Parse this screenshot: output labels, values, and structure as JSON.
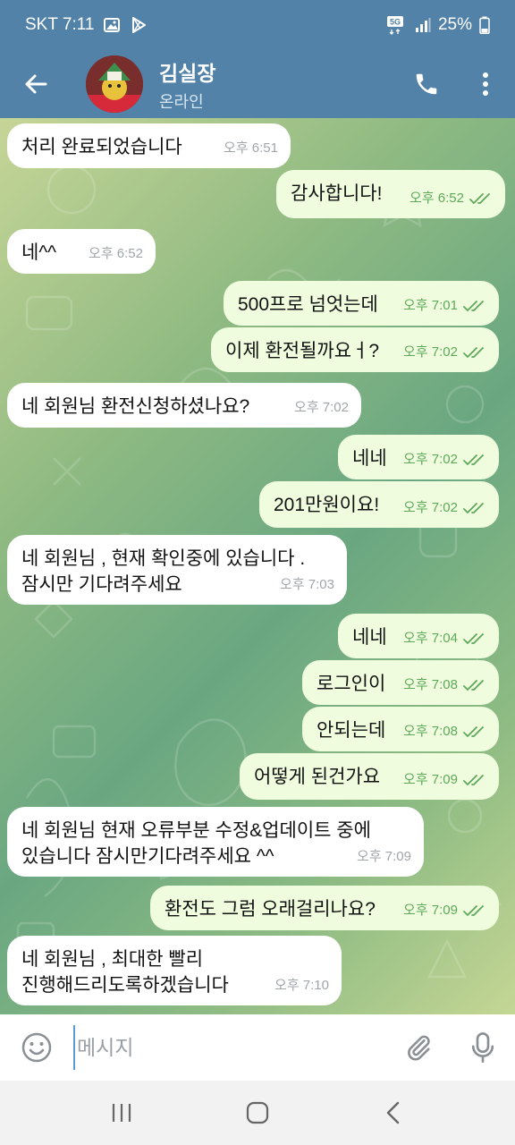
{
  "status_bar": {
    "carrier_time": "SKT 7:11",
    "network": "5G",
    "battery": "25%",
    "icons": [
      "image-icon",
      "play-store-icon",
      "5g-icon",
      "signal-icon",
      "battery-icon"
    ]
  },
  "header": {
    "name": "김실장",
    "status": "온라인",
    "icons": [
      "back-arrow-icon",
      "phone-icon",
      "more-vert-icon"
    ]
  },
  "messages": [
    {
      "dir": "in",
      "text": "처리 완료되었습니다",
      "time": "오후 6:51"
    },
    {
      "dir": "out",
      "text": "감사합니다!",
      "time": "오후 6:52",
      "read": true
    },
    {
      "dir": "in",
      "text": "네^^",
      "time": "오후 6:52"
    },
    {
      "dir": "out",
      "text": "500프로 넘엇는데",
      "time": "오후 7:01",
      "read": true
    },
    {
      "dir": "out",
      "text": "이제 환전될까요ㅓ?",
      "time": "오후 7:02",
      "read": true
    },
    {
      "dir": "in",
      "text": "네 회원님 환전신청하셨나요?",
      "time": "오후 7:02"
    },
    {
      "dir": "out",
      "text": "네네",
      "time": "오후 7:02",
      "read": true
    },
    {
      "dir": "out",
      "text": "201만원이요!",
      "time": "오후 7:02",
      "read": true
    },
    {
      "dir": "in",
      "text": "네 회원님 , 현재 확인중에 있습니다 .\n잠시만 기다려주세요",
      "time": "오후 7:03"
    },
    {
      "dir": "out",
      "text": "네네",
      "time": "오후 7:04",
      "read": true
    },
    {
      "dir": "out",
      "text": "로그인이",
      "time": "오후 7:08",
      "read": true
    },
    {
      "dir": "out",
      "text": "안되는데",
      "time": "오후 7:08",
      "read": true
    },
    {
      "dir": "out",
      "text": "어떻게 된건가요",
      "time": "오후 7:09",
      "read": true
    },
    {
      "dir": "in",
      "text": "네 회원님 현재 오류부분 수정&업데이트 중에\n있습니다 잠시만기다려주세요 ^^",
      "time": "오후 7:09"
    },
    {
      "dir": "out",
      "text": "환전도 그럼 오래걸리나요?",
      "time": "오후 7:09",
      "read": true
    },
    {
      "dir": "in",
      "text": "네 회원님 , 최대한 빨리\n진행해드리도록하겠습니다",
      "time": "오후 7:10"
    }
  ],
  "input": {
    "placeholder": "메시지",
    "icons": [
      "emoji-icon",
      "attach-icon",
      "mic-icon"
    ]
  },
  "nav": {
    "icons": [
      "recent-apps-icon",
      "home-icon",
      "back-icon"
    ]
  },
  "colors": {
    "header": "#5282a8",
    "incoming_bubble": "#ffffff",
    "outgoing_bubble": "#effdde",
    "outgoing_meta": "#5ea85a",
    "incoming_meta": "#a0a5aa"
  }
}
